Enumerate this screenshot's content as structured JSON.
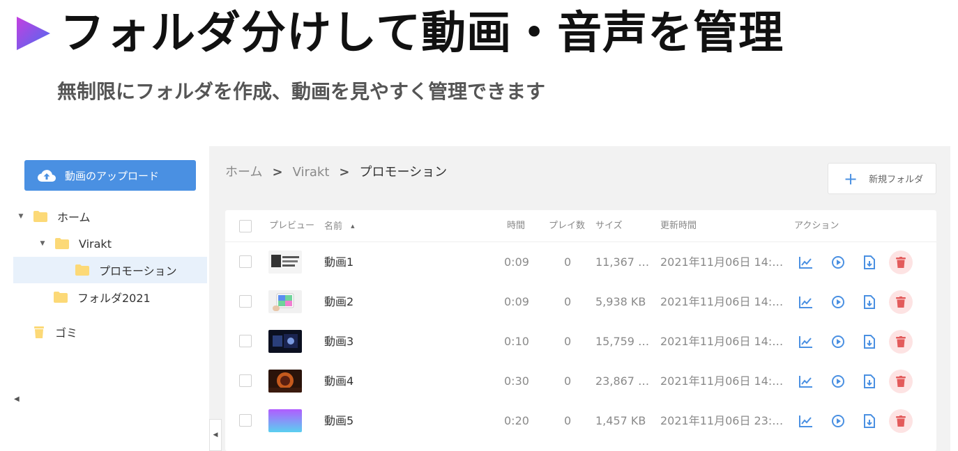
{
  "hero": {
    "title": "フォルダ分けして動画・音声を管理",
    "subtitle": "無制限にフォルダを作成、動画を見やすく管理できます"
  },
  "sidebar": {
    "upload_label": "動画のアップロード",
    "tree": [
      {
        "label": "ホーム"
      },
      {
        "label": "Virakt"
      },
      {
        "label": "プロモーション"
      },
      {
        "label": "フォルダ2021"
      }
    ],
    "trash_label": "ゴミ"
  },
  "breadcrumb": {
    "items": [
      "ホーム",
      "Virakt",
      "プロモーション"
    ],
    "separator": ">"
  },
  "toolbar": {
    "new_folder_label": "新規フォルダ"
  },
  "table": {
    "headers": {
      "preview": "プレビュー",
      "name": "名前",
      "time": "時間",
      "plays": "プレイ数",
      "size": "サイズ",
      "updated": "更新時間",
      "actions": "アクション"
    },
    "sort_indicator": "▲",
    "rows": [
      {
        "name": "動画1",
        "time": "0:09",
        "plays": "0",
        "size": "11,367 …",
        "updated": "2021年11月06日 14:…",
        "thumb": "content"
      },
      {
        "name": "動画2",
        "time": "0:09",
        "plays": "0",
        "size": "5,938 KB",
        "updated": "2021年11月06日 14:…",
        "thumb": "tablet"
      },
      {
        "name": "動画3",
        "time": "0:10",
        "plays": "0",
        "size": "15,759 …",
        "updated": "2021年11月06日 14:…",
        "thumb": "dark"
      },
      {
        "name": "動画4",
        "time": "0:30",
        "plays": "0",
        "size": "23,867 …",
        "updated": "2021年11月06日 14:…",
        "thumb": "stage"
      },
      {
        "name": "動画5",
        "time": "0:20",
        "plays": "0",
        "size": "1,457 KB",
        "updated": "2021年11月06日 23:…",
        "thumb": "gradient"
      }
    ]
  },
  "colors": {
    "accent": "#4a90e2",
    "delete": "#e35b5b",
    "delete_bg": "#fde3e3",
    "folder": "#fcd977"
  },
  "icons": {
    "upload": "cloud-upload-icon",
    "folder": "folder-icon",
    "trash": "trash-icon",
    "stats": "chart-line-icon",
    "play": "play-circle-icon",
    "download": "file-download-icon",
    "delete": "delete-icon"
  }
}
